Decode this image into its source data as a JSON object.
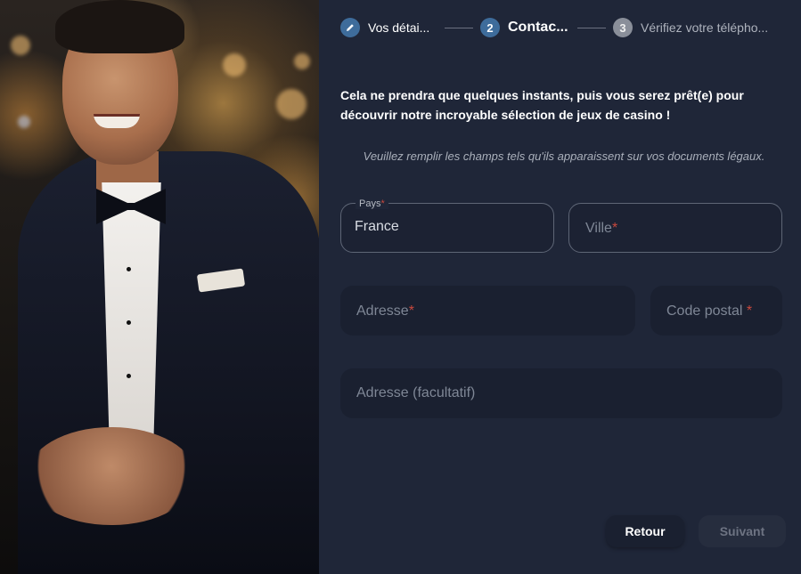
{
  "stepper": {
    "steps": [
      {
        "number": "",
        "label": "Vos détai...",
        "state": "done",
        "icon": "pencil-icon"
      },
      {
        "number": "2",
        "label": "Contac...",
        "state": "active"
      },
      {
        "number": "3",
        "label": "Vérifiez votre télépho...",
        "state": "pending"
      }
    ]
  },
  "intro": "Cela ne prendra que quelques instants, puis vous serez prêt(e) pour découvrir notre incroyable sélection de jeux de casino !",
  "note": "Veuillez remplir les champs tels qu'ils apparaissent sur vos documents légaux.",
  "form": {
    "country": {
      "label": "Pays",
      "value": "France"
    },
    "city": {
      "placeholder": "Ville"
    },
    "address": {
      "placeholder": "Adresse"
    },
    "postal_code": {
      "placeholder": "Code postal"
    },
    "address_optional": {
      "placeholder": "Adresse (facultatif)"
    },
    "required_mark": "*"
  },
  "buttons": {
    "back": "Retour",
    "next": "Suivant"
  },
  "colors": {
    "panel_bg": "#1f2638",
    "accent": "#3e6c9b",
    "required": "#c9483d"
  }
}
